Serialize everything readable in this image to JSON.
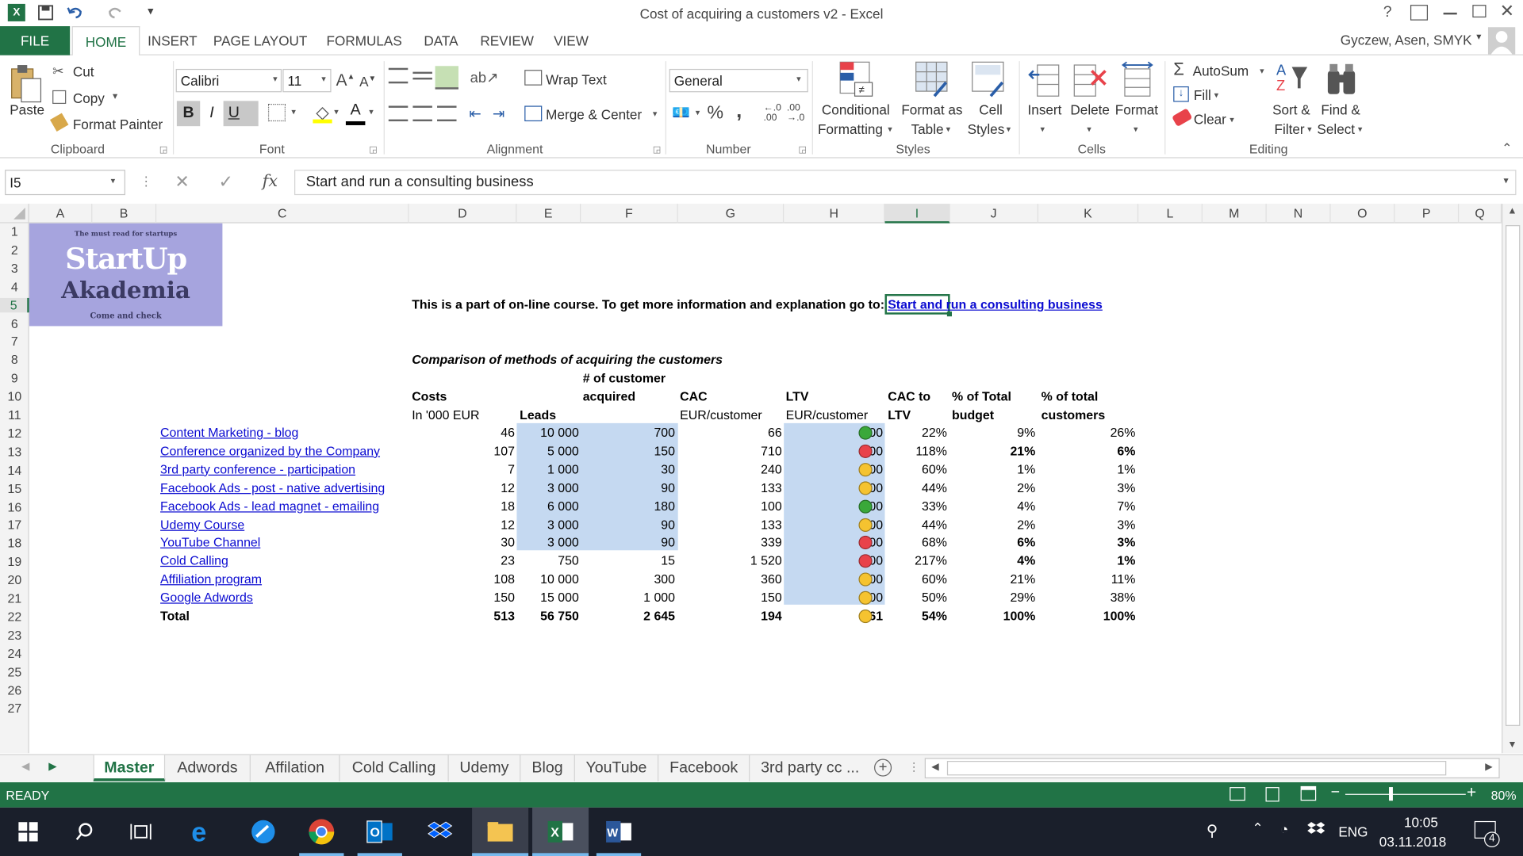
{
  "window": {
    "title": "Cost of acquiring a customers v2 - Excel",
    "help": "?",
    "user": "Gyczew, Asen, SMYK"
  },
  "ribbon_tabs": [
    "FILE",
    "HOME",
    "INSERT",
    "PAGE LAYOUT",
    "FORMULAS",
    "DATA",
    "REVIEW",
    "VIEW"
  ],
  "ribbon": {
    "clipboard": {
      "paste": "Paste",
      "cut": "Cut",
      "copy": "Copy",
      "format_painter": "Format Painter",
      "label": "Clipboard"
    },
    "font": {
      "name": "Calibri",
      "size": "11",
      "label": "Font",
      "bold": "B",
      "italic": "I",
      "underline": "U"
    },
    "alignment": {
      "wrap": "Wrap Text",
      "merge": "Merge & Center",
      "label": "Alignment"
    },
    "number": {
      "format": "General",
      "label": "Number",
      "percent": "%",
      "comma": ","
    },
    "styles": {
      "conditional_1": "Conditional",
      "conditional_2": "Formatting",
      "format_table_1": "Format as",
      "format_table_2": "Table",
      "cell_styles_1": "Cell",
      "cell_styles_2": "Styles",
      "label": "Styles"
    },
    "cells": {
      "insert": "Insert",
      "delete": "Delete",
      "format": "Format",
      "label": "Cells"
    },
    "editing": {
      "autosum": "AutoSum",
      "fill": "Fill",
      "clear": "Clear",
      "sort_1": "Sort &",
      "sort_2": "Filter",
      "find_1": "Find &",
      "find_2": "Select",
      "label": "Editing"
    }
  },
  "formula_bar": {
    "name_box": "I5",
    "fx": "fx",
    "content": "Start and run a consulting business"
  },
  "columns": [
    "A",
    "B",
    "C",
    "D",
    "E",
    "F",
    "G",
    "H",
    "I",
    "J",
    "K",
    "L",
    "M",
    "N",
    "O",
    "P",
    "Q"
  ],
  "rows": [
    "1",
    "2",
    "3",
    "4",
    "5",
    "6",
    "7",
    "8",
    "9",
    "10",
    "11",
    "12",
    "13",
    "14",
    "15",
    "16",
    "17",
    "18",
    "19",
    "20",
    "21",
    "22",
    "23",
    "24",
    "25",
    "26",
    "27"
  ],
  "logo": {
    "top": "The must read for startups",
    "line1": "StartUp",
    "line2": "Akademia",
    "bottom": "Come and check"
  },
  "sheet": {
    "intro": "This is a part of on-line course. To get more information and explanation go to:",
    "intro_link": "Start and run a consulting business",
    "table_title": "Comparison of methods of acquiring the customers",
    "headers": {
      "costs": "Costs",
      "costs_unit": "In '000 EUR",
      "leads": "Leads",
      "acquired_1": "# of customer",
      "acquired_2": "acquired",
      "cac": "CAC",
      "cac_unit": "EUR/customer",
      "ltv": "LTV",
      "ltv_unit": "EUR/customer",
      "cac_ltv_1": "CAC to",
      "cac_ltv_2": "LTV",
      "budget_1": "% of Total",
      "budget_2": "budget",
      "cust_1": "% of total",
      "cust_2": "customers"
    },
    "data_rows": [
      {
        "method": "Content Marketing - blog",
        "costs": "46",
        "leads": "10 000",
        "acquired": "700",
        "cac": "66",
        "ltv": "300",
        "status": "green",
        "ratio": "22%",
        "budget": "9%",
        "cust": "26%",
        "bold_pct": false
      },
      {
        "method": "Conference organized by the Company",
        "costs": "107",
        "leads": "5 000",
        "acquired": "150",
        "cac": "710",
        "ltv": "600",
        "status": "red",
        "ratio": "118%",
        "budget": "21%",
        "cust": "6%",
        "bold_pct": true
      },
      {
        "method": "3rd party conference - participation",
        "costs": "7",
        "leads": "1 000",
        "acquired": "30",
        "cac": "240",
        "ltv": "400",
        "status": "yellow",
        "ratio": "60%",
        "budget": "1%",
        "cust": "1%",
        "bold_pct": false
      },
      {
        "method": "Facebook Ads - post - native advertising",
        "costs": "12",
        "leads": "3 000",
        "acquired": "90",
        "cac": "133",
        "ltv": "300",
        "status": "yellow",
        "ratio": "44%",
        "budget": "2%",
        "cust": "3%",
        "bold_pct": false
      },
      {
        "method": "Facebook Ads - lead magnet - emailing",
        "costs": "18",
        "leads": "6 000",
        "acquired": "180",
        "cac": "100",
        "ltv": "300",
        "status": "green",
        "ratio": "33%",
        "budget": "4%",
        "cust": "7%",
        "bold_pct": false
      },
      {
        "method": "Udemy Course",
        "costs": "12",
        "leads": "3 000",
        "acquired": "90",
        "cac": "133",
        "ltv": "300",
        "status": "yellow",
        "ratio": "44%",
        "budget": "2%",
        "cust": "3%",
        "bold_pct": false
      },
      {
        "method": "YouTube Channel",
        "costs": "30",
        "leads": "3 000",
        "acquired": "90",
        "cac": "339",
        "ltv": "500",
        "status": "red",
        "ratio": "68%",
        "budget": "6%",
        "cust": "3%",
        "bold_pct": true
      },
      {
        "method": "Cold Calling",
        "costs": "23",
        "leads": "750",
        "acquired": "15",
        "cac": "1 520",
        "ltv": "700",
        "status": "red",
        "ratio": "217%",
        "budget": "4%",
        "cust": "1%",
        "bold_pct": true
      },
      {
        "method": "Affiliation program",
        "costs": "108",
        "leads": "10 000",
        "acquired": "300",
        "cac": "360",
        "ltv": "600",
        "status": "yellow",
        "ratio": "60%",
        "budget": "21%",
        "cust": "11%",
        "bold_pct": false
      },
      {
        "method": "Google Adwords",
        "costs": "150",
        "leads": "15 000",
        "acquired": "1 000",
        "cac": "150",
        "ltv": "300",
        "status": "yellow",
        "ratio": "50%",
        "budget": "29%",
        "cust": "38%",
        "bold_pct": false
      }
    ],
    "total": {
      "label": "Total",
      "costs": "513",
      "leads": "56 750",
      "acquired": "2 645",
      "cac": "194",
      "ltv": "361",
      "status": "yellow",
      "ratio": "54%",
      "budget": "100%",
      "cust": "100%"
    }
  },
  "colors": {
    "excel_green": "#217346",
    "highlight": "#c5d9f1",
    "green": "#3aa83a",
    "red": "#e8424a",
    "yellow": "#f5c330",
    "link": "#0b0bd1"
  },
  "sheet_tabs": [
    "Master",
    "Adwords",
    "Affilation",
    "Cold Calling",
    "Udemy",
    "Blog",
    "YouTube",
    "Facebook",
    "3rd party cc ..."
  ],
  "status": {
    "ready": "READY",
    "zoom": "80%"
  },
  "taskbar": {
    "lang": "ENG",
    "time": "10:05",
    "date": "03.11.2018",
    "notif": "4"
  }
}
